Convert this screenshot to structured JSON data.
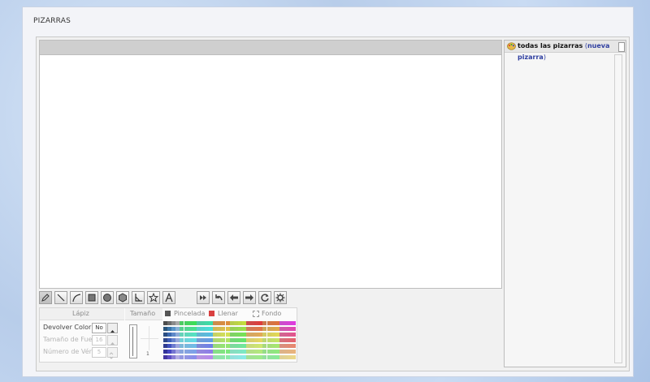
{
  "page": {
    "title": "PIZARRAS"
  },
  "sidebar": {
    "all_label": "todas las pizarras",
    "new_link_open": "(",
    "new_link": "nueva pizarra",
    "new_link_close": ")"
  },
  "tools": [
    {
      "name": "pencil-tool",
      "icon": "pencil-icon"
    },
    {
      "name": "line-tool",
      "icon": "line-icon"
    },
    {
      "name": "curve-tool",
      "icon": "curve-icon"
    },
    {
      "name": "rectangle-tool",
      "icon": "square-icon"
    },
    {
      "name": "ellipse-tool",
      "icon": "circle-icon"
    },
    {
      "name": "polygon-tool",
      "icon": "hexagon-icon"
    },
    {
      "name": "angle-tool",
      "icon": "angle-icon"
    },
    {
      "name": "star-tool",
      "icon": "star-icon"
    },
    {
      "name": "text-tool",
      "icon": "text-a-icon"
    },
    {
      "name": "fast-forward-button",
      "icon": "fast-forward-icon"
    },
    {
      "name": "undo-button",
      "icon": "undo-icon"
    },
    {
      "name": "back-button",
      "icon": "arrow-left-icon"
    },
    {
      "name": "forward-button",
      "icon": "arrow-right-icon"
    },
    {
      "name": "refresh-button",
      "icon": "refresh-icon"
    },
    {
      "name": "settings-button",
      "icon": "gear-icon"
    }
  ],
  "options": {
    "pencil_header": "Lápiz",
    "size_header": "Tamaño",
    "stroke_label": "Pincelada",
    "fill_label": "Llenar",
    "background_label": "Fondo",
    "return_color_label": "Devolver Color",
    "return_color_value": "No",
    "font_size_label": "Tamaño de Fue",
    "font_size_value": "16",
    "vertex_count_label": "Número de Vért",
    "vertex_count_value": "5",
    "size_value": "1"
  },
  "colors": {
    "stroke": "#555555",
    "fill": "#d94040",
    "link": "#2e3ea0"
  }
}
